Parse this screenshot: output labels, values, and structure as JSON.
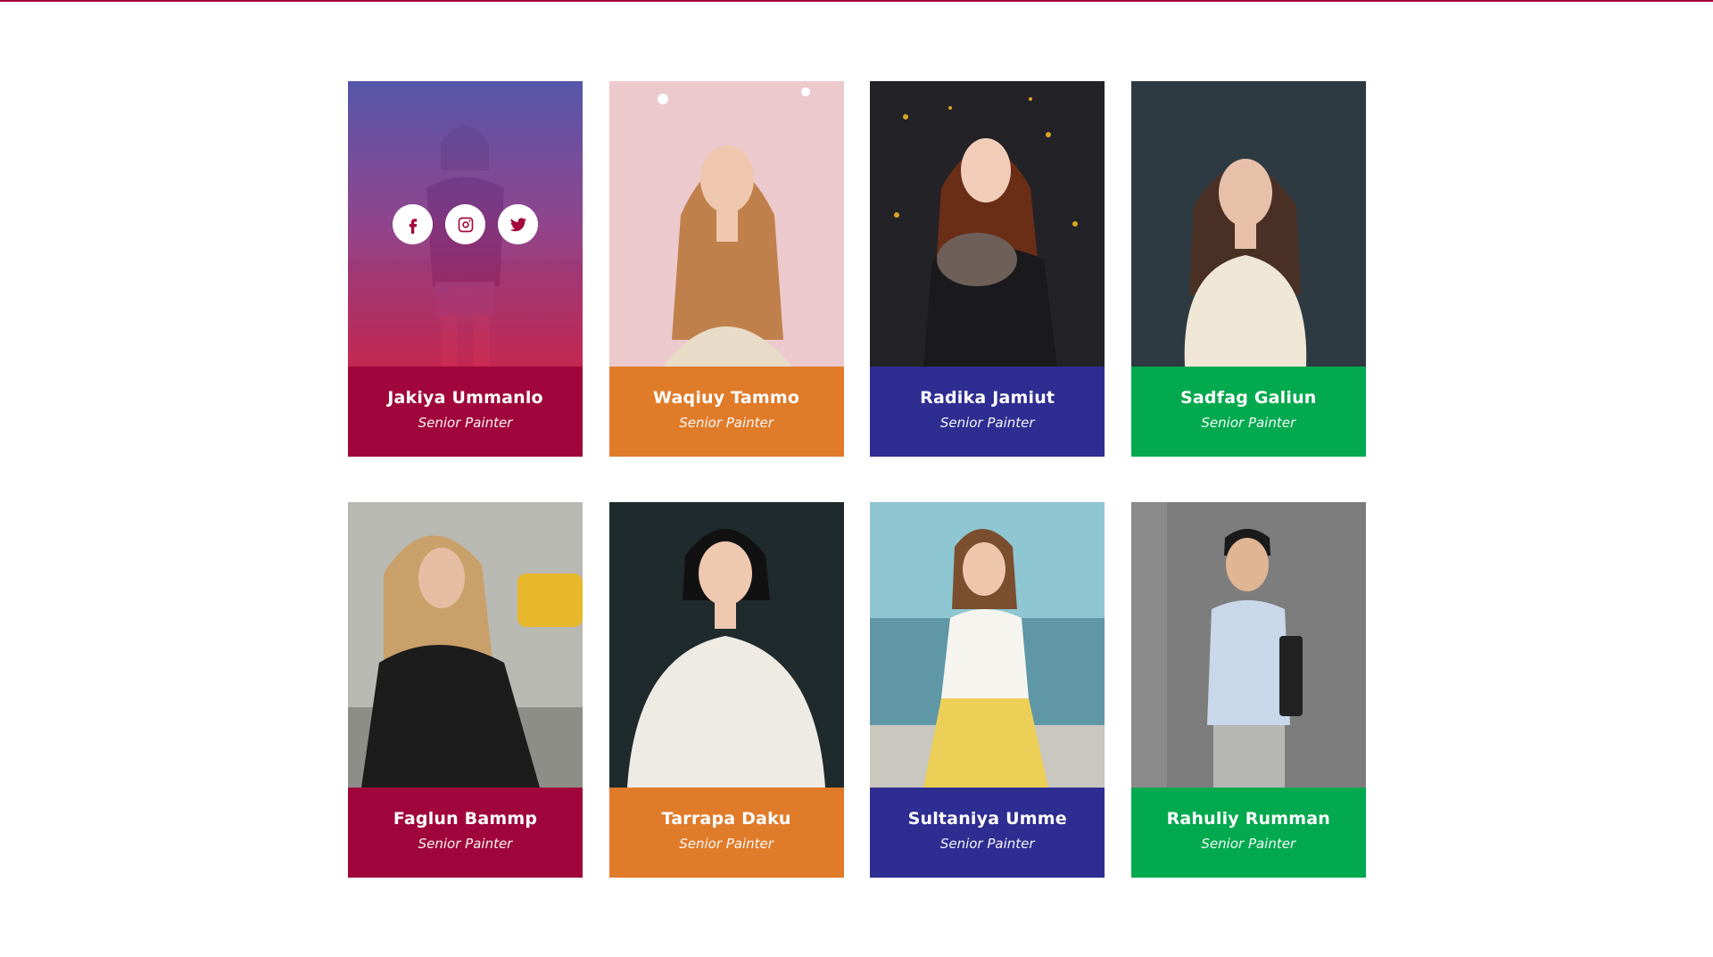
{
  "colors": {
    "crimson": "#a0063b",
    "orange": "#e07b2a",
    "indigo": "#2e2d91",
    "green": "#03a94f",
    "accent_line": "#a3083c"
  },
  "social_icons": [
    "facebook-icon",
    "instagram-icon",
    "twitter-icon"
  ],
  "team": [
    {
      "name": "Jakiya Ummanlo",
      "role": "Senior Painter",
      "color": "crimson",
      "hovered": true
    },
    {
      "name": "Waqiuy Tammo",
      "role": "Senior Painter",
      "color": "orange"
    },
    {
      "name": "Radika Jamiut",
      "role": "Senior Painter",
      "color": "indigo"
    },
    {
      "name": "Sadfag Galiun",
      "role": "Senior Painter",
      "color": "green"
    },
    {
      "name": "Faglun Bammp",
      "role": "Senior Painter",
      "color": "crimson"
    },
    {
      "name": "Tarrapa Daku",
      "role": "Senior Painter",
      "color": "orange"
    },
    {
      "name": "Sultaniya Umme",
      "role": "Senior Painter",
      "color": "indigo"
    },
    {
      "name": "Rahuliy Rumman",
      "role": "Senior Painter",
      "color": "green"
    }
  ]
}
